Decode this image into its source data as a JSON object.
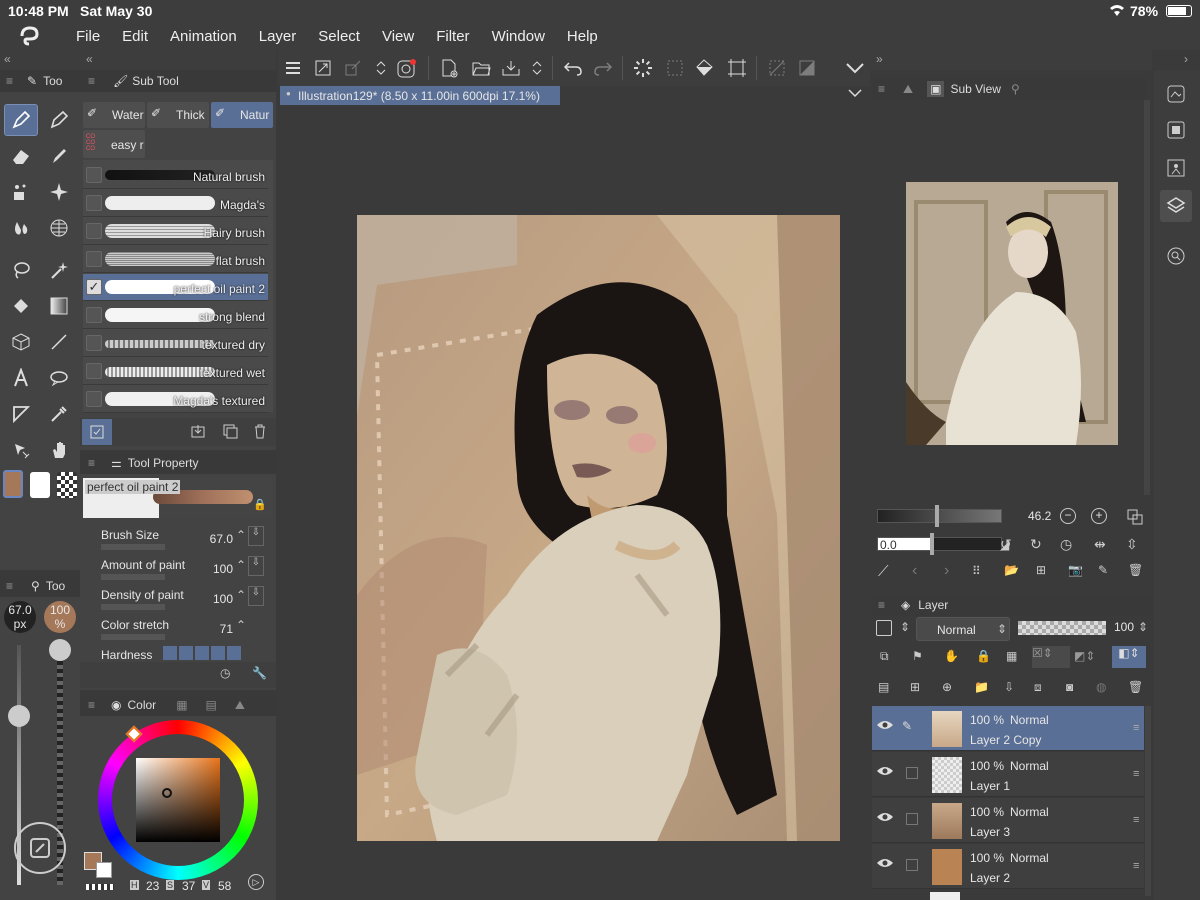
{
  "status": {
    "time": "10:48 PM",
    "date": "Sat May 30",
    "battery": "78%"
  },
  "menu": {
    "items": [
      "File",
      "Edit",
      "Animation",
      "Layer",
      "Select",
      "View",
      "Filter",
      "Window",
      "Help"
    ]
  },
  "document": {
    "tab_title": "Illustration129* (8.50 x 11.00in 600dpi 17.1%)"
  },
  "tool_panel": {
    "title": "Too"
  },
  "subtool": {
    "title": "Sub Tool",
    "tabs": [
      "Water",
      "Thick",
      "Natur"
    ],
    "group_label": "easy r",
    "brushes": [
      {
        "name": "Natural brush",
        "checked": false,
        "selected": false
      },
      {
        "name": "Magda's",
        "checked": false,
        "selected": false
      },
      {
        "name": "Hairy brush",
        "checked": false,
        "selected": false
      },
      {
        "name": "flat brush",
        "checked": false,
        "selected": false
      },
      {
        "name": "perfect oil paint 2",
        "checked": true,
        "selected": true
      },
      {
        "name": "strong blend",
        "checked": false,
        "selected": false
      },
      {
        "name": "textured dry",
        "checked": false,
        "selected": false
      },
      {
        "name": "textured wet",
        "checked": false,
        "selected": false
      },
      {
        "name": "Magda's textured",
        "checked": false,
        "selected": false
      }
    ]
  },
  "tool_property": {
    "title": "Tool Property",
    "brush_name": "perfect oil paint 2",
    "props": [
      {
        "label": "Brush Size",
        "value": "67.0"
      },
      {
        "label": "Amount of paint",
        "value": "100"
      },
      {
        "label": "Density of paint",
        "value": "100"
      },
      {
        "label": "Color stretch",
        "value": "71"
      },
      {
        "label": "Hardness",
        "value": ""
      }
    ]
  },
  "size_panel": {
    "title": "Too",
    "size_value": "67.0",
    "size_unit": "px",
    "opacity_value": "100",
    "opacity_unit": "%"
  },
  "color": {
    "title": "Color",
    "h_label": "H",
    "h": "23",
    "s_label": "S",
    "s": "37",
    "v_label": "V",
    "v": "58",
    "main_color": "#a5785a"
  },
  "subview": {
    "title": "Sub View",
    "zoom": "46.2",
    "angle": "0.0"
  },
  "layer_panel": {
    "title": "Layer",
    "blend_mode": "Normal",
    "opacity": "100",
    "layers": [
      {
        "opacity": "100 %",
        "mode": "Normal",
        "name": "Layer 2 Copy",
        "active": true
      },
      {
        "opacity": "100 %",
        "mode": "Normal",
        "name": "Layer 1",
        "active": false
      },
      {
        "opacity": "100 %",
        "mode": "Normal",
        "name": "Layer 3",
        "active": false
      },
      {
        "opacity": "100 %",
        "mode": "Normal",
        "name": "Layer 2",
        "active": false
      }
    ]
  }
}
